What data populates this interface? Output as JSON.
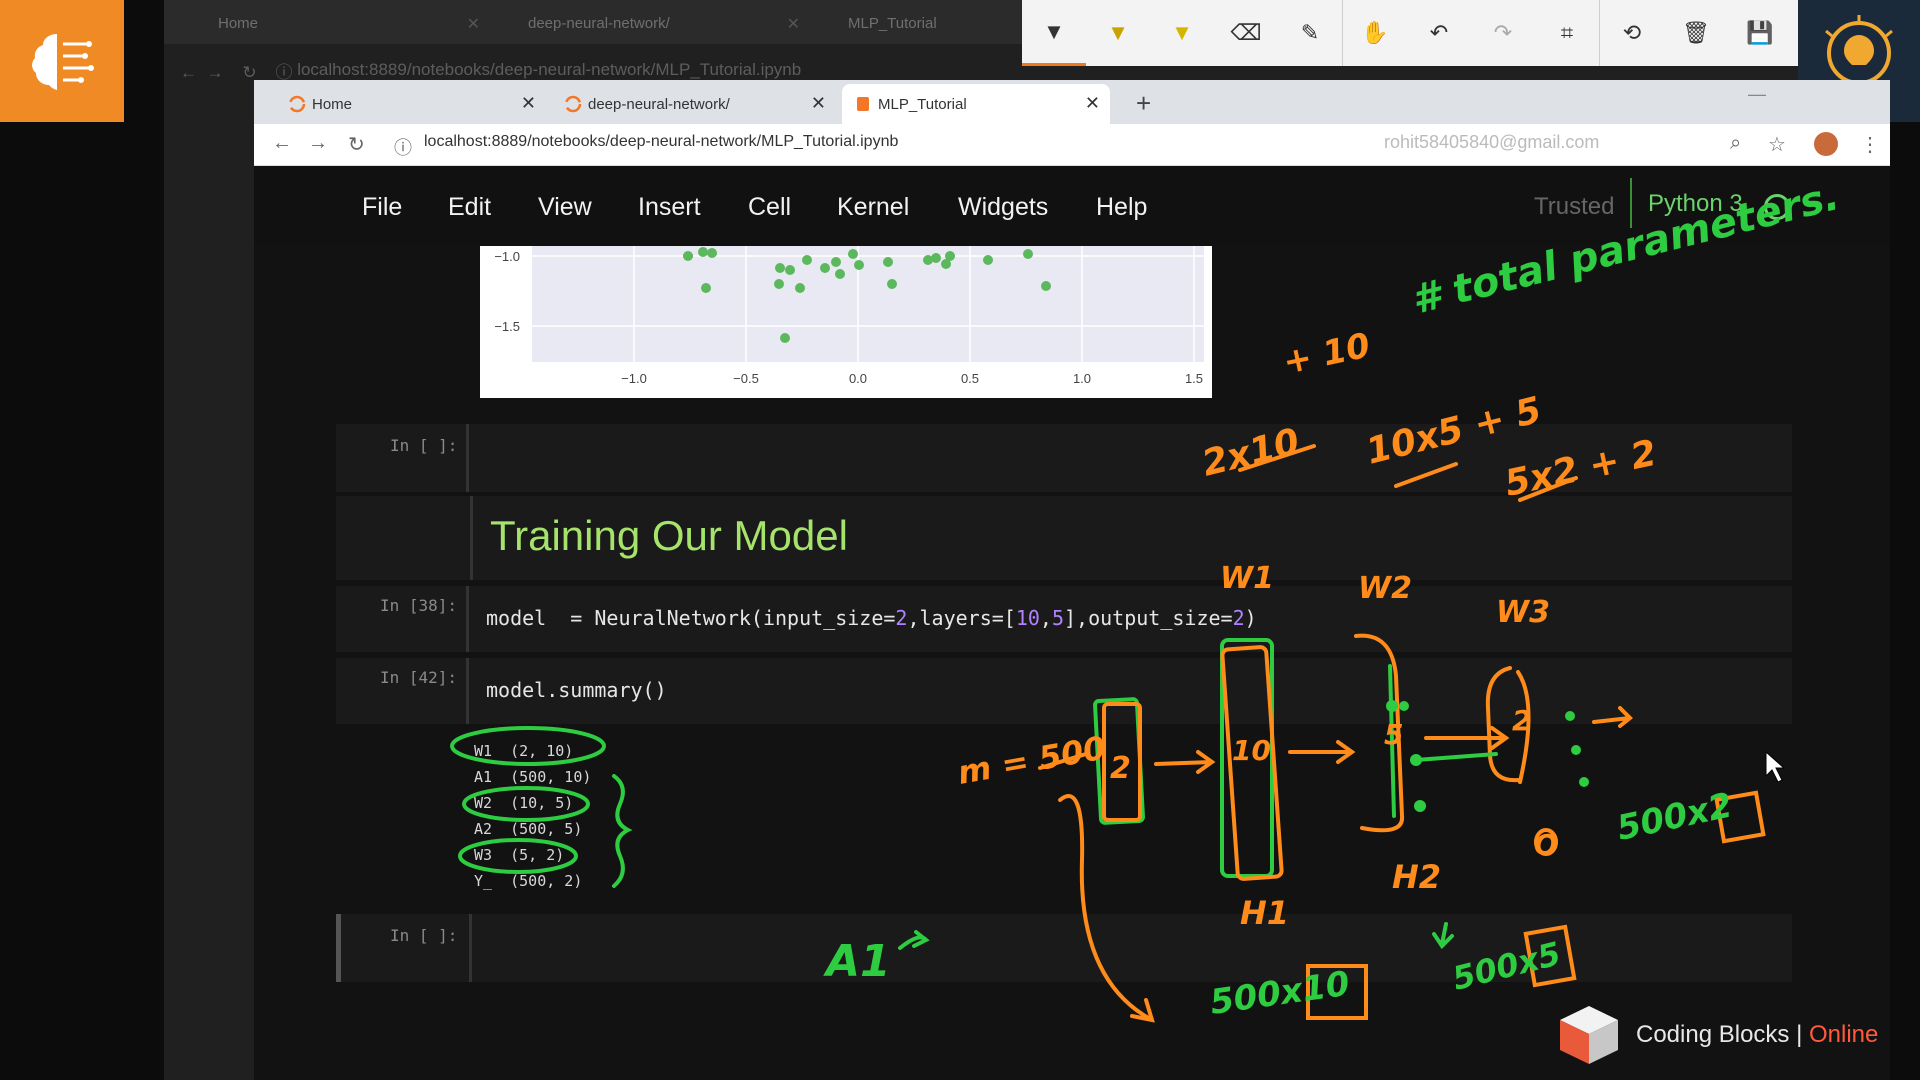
{
  "background_browser": {
    "tabs": [
      {
        "label": "Home"
      },
      {
        "label": "deep-neural-network/"
      },
      {
        "label": "MLP_Tutorial"
      }
    ],
    "url": "localhost:8889/notebooks/deep-neural-network/MLP_Tutorial.ipynb"
  },
  "annotation_toolbar": {
    "tools": [
      "pen-icon",
      "marker-icon",
      "highlighter-icon",
      "eraser-icon",
      "ruler-icon",
      "hand-icon",
      "undo-icon",
      "redo-icon",
      "crop-icon",
      "history-icon",
      "trash-icon",
      "save-icon"
    ]
  },
  "browser": {
    "tabs": [
      {
        "label": "Home",
        "active": false
      },
      {
        "label": "deep-neural-network/",
        "active": false
      },
      {
        "label": "MLP_Tutorial",
        "active": true
      }
    ],
    "url": "localhost:8889/notebooks/deep-neural-network/MLP_Tutorial.ipynb",
    "account": "rohit58405840@gmail.com"
  },
  "jupyter": {
    "menu": [
      "File",
      "Edit",
      "View",
      "Insert",
      "Cell",
      "Kernel",
      "Widgets",
      "Help"
    ],
    "trusted": "Trusted",
    "kernel": "Python 3"
  },
  "plot": {
    "y_ticks": [
      "−1.0",
      "−1.5"
    ],
    "x_ticks": [
      "−1.0",
      "−0.5",
      "0.0",
      "0.5",
      "1.0",
      "1.5"
    ]
  },
  "cells": {
    "empty1_prompt": "In [ ]:",
    "heading": "Training Our Model",
    "cell38_prompt": "In [38]:",
    "cell38_code": {
      "a": "model  = NeuralNetwork(input_size=",
      "b": "2",
      "c": ",layers=[",
      "d": "10",
      "e": ",",
      "f": "5",
      "g": "],output_size=",
      "h": "2",
      "i": ")"
    },
    "cell42_prompt": "In [42]:",
    "cell42_code": "model.summary()",
    "cell42_output": [
      "W1  (2, 10)",
      "A1  (500, 10)",
      "W2  (10, 5)",
      "A2  (500, 5)",
      "W3  (5, 2)",
      "Y_  (500, 2)"
    ],
    "empty2_prompt": "In [ ]:"
  },
  "handwriting": {
    "total_params": "# total parameters.",
    "plus10": "+ 10",
    "l1": "2x10",
    "l2": "10x5 + 5",
    "l3": "5x2 + 2",
    "w1": "W1",
    "w2": "W2",
    "w3": "W3",
    "m": "m = 500",
    "in_box": "2",
    "h1_box": "10",
    "h2_box": "5",
    "out_box": "2",
    "h1": "H1",
    "h2": "H2",
    "o": "O",
    "a1": "A1",
    "out_shape": "500x2",
    "h1_shape": "500x10",
    "h2_shape": "500x5"
  },
  "branding": {
    "name": "Coding Blocks",
    "suffix": "Online"
  }
}
